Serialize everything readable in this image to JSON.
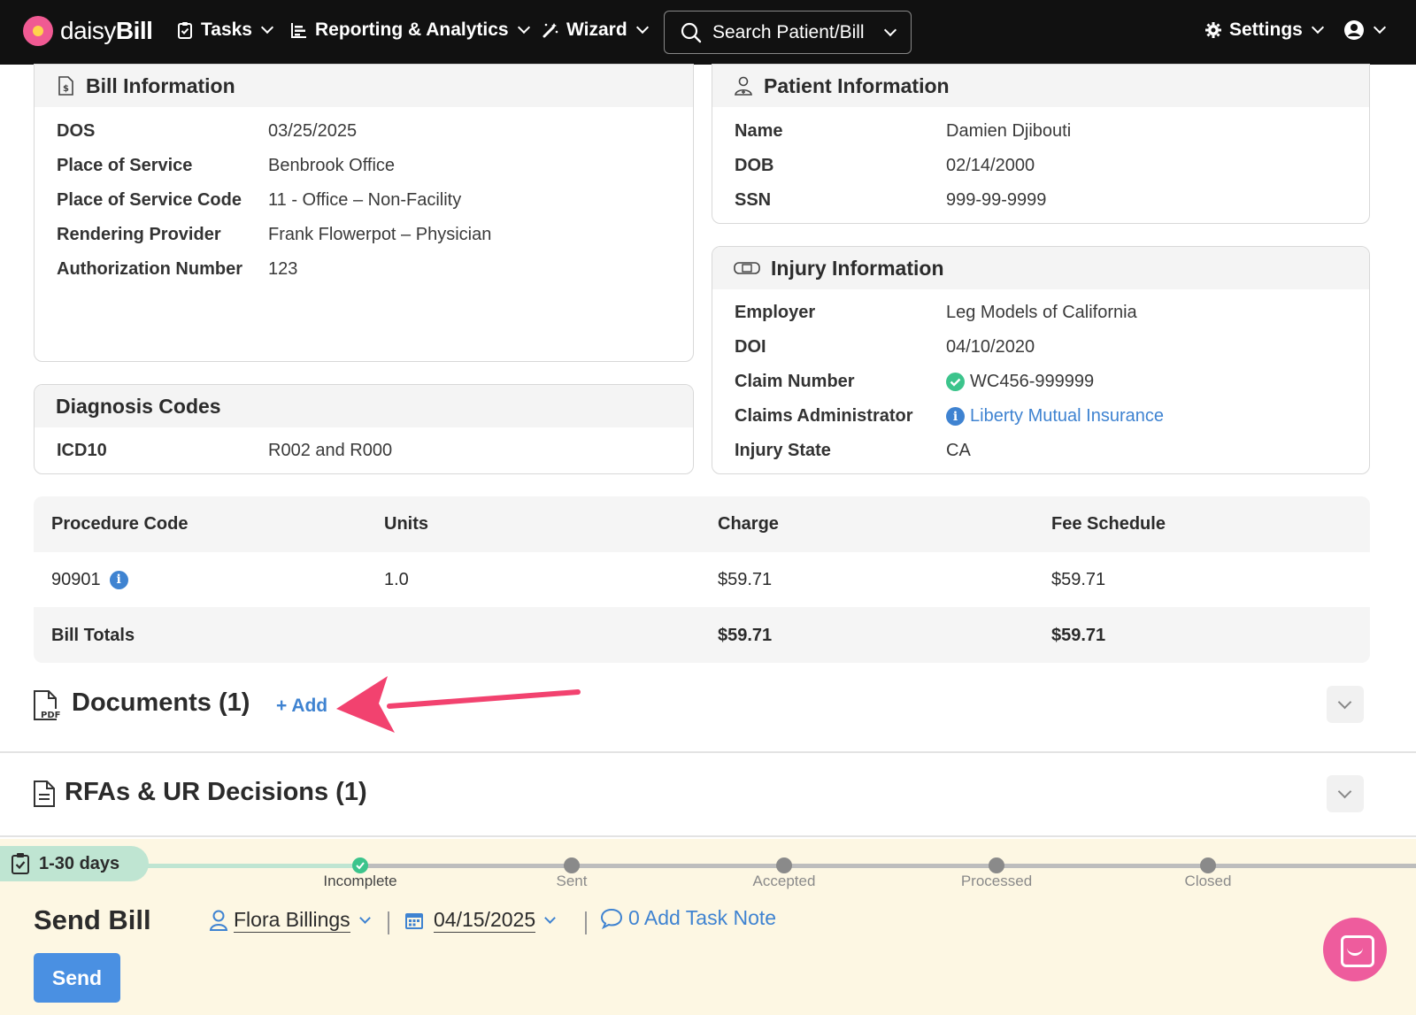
{
  "nav": {
    "brand_light": "daisy",
    "brand_bold": "Bill",
    "tasks": "Tasks",
    "reporting": "Reporting & Analytics",
    "wizard": "Wizard",
    "search": "Search Patient/Bill",
    "settings": "Settings"
  },
  "bill_info": {
    "title": "Bill Information",
    "rows": [
      {
        "label": "DOS",
        "value": "03/25/2025"
      },
      {
        "label": "Place of Service",
        "value": "Benbrook Office"
      },
      {
        "label": "Place of Service Code",
        "value": "11 - Office – Non-Facility"
      },
      {
        "label": "Rendering Provider",
        "value": "Frank Flowerpot – Physician"
      },
      {
        "label": "Authorization Number",
        "value": "123"
      }
    ]
  },
  "patient_info": {
    "title": "Patient Information",
    "rows": [
      {
        "label": "Name",
        "value": "Damien Djibouti"
      },
      {
        "label": "DOB",
        "value": "02/14/2000"
      },
      {
        "label": "SSN",
        "value": "999-99-9999"
      }
    ]
  },
  "diagnosis": {
    "title": "Diagnosis Codes",
    "label": "ICD10",
    "value": "R002 and R000"
  },
  "injury_info": {
    "title": "Injury Information",
    "rows": [
      {
        "label": "Employer",
        "value": "Leg Models of California"
      },
      {
        "label": "DOI",
        "value": "04/10/2020"
      },
      {
        "label": "Claim Number",
        "value": "WC456-999999"
      },
      {
        "label": "Claims Administrator",
        "value": "Liberty Mutual Insurance"
      },
      {
        "label": "Injury State",
        "value": "CA"
      }
    ]
  },
  "procedures": {
    "headers": [
      "Procedure Code",
      "Units",
      "Charge",
      "Fee Schedule"
    ],
    "rows": [
      {
        "code": "90901",
        "units": "1.0",
        "charge": "$59.71",
        "fee": "$59.71"
      }
    ],
    "totals": {
      "label": "Bill Totals",
      "charge": "$59.71",
      "fee": "$59.71"
    }
  },
  "documents": {
    "title": "Documents (1)",
    "add_label": "+ Add"
  },
  "rfas": {
    "title": "RFAs & UR Decisions (1)"
  },
  "task": {
    "days": "1-30 days",
    "steps": [
      "Incomplete",
      "Sent",
      "Accepted",
      "Processed",
      "Closed"
    ],
    "title": "Send Bill",
    "assignee": "Flora Billings",
    "date": "04/15/2025",
    "note": "0 Add Task Note",
    "send_label": "Send"
  },
  "colors": {
    "accent_blue": "#3f83d1",
    "arrow_pink": "#f2426f",
    "success_green": "#3cc48c",
    "task_bg": "#fdf7e3"
  }
}
